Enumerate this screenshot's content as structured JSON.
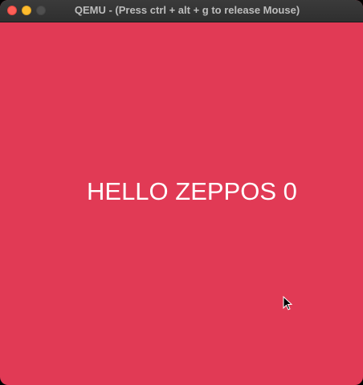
{
  "window": {
    "title": "QEMU - (Press ctrl + alt + g to release Mouse)",
    "controls": [
      "close",
      "minimize",
      "zoom"
    ]
  },
  "screen": {
    "background_color": "#e13a55",
    "text": "HELLO ZEPPOS 0",
    "text_color": "#ffffff"
  },
  "icons": {
    "cursor": "mouse-pointer-icon"
  }
}
